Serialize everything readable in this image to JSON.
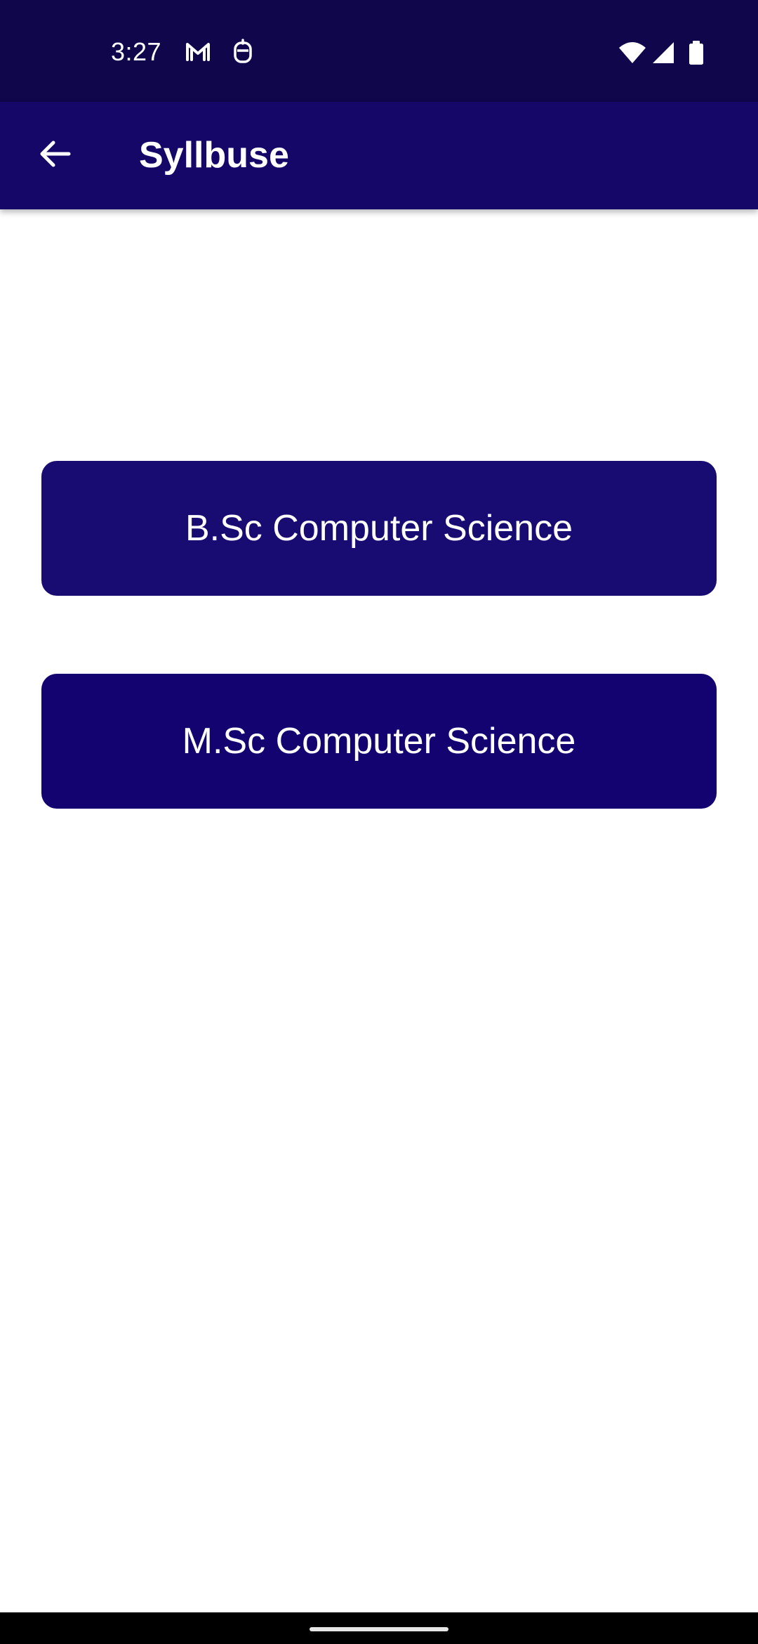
{
  "status_bar": {
    "time": "3:27",
    "notification_icons": [
      "gmail-icon",
      "notification-icon"
    ],
    "system_icons": [
      "wifi-icon",
      "cellular-signal-icon",
      "battery-icon"
    ]
  },
  "app_bar": {
    "back_icon": "arrow-left-icon",
    "title": "Syllbuse"
  },
  "courses": [
    {
      "label": "B.Sc Computer Science"
    },
    {
      "label": "M.Sc Computer Science"
    }
  ],
  "colors": {
    "status_bar": "#0f064b",
    "app_bar": "#150767",
    "button_bsc": "#180c72",
    "button_msc": "#130371",
    "text": "#ffffff",
    "background": "#ffffff"
  }
}
